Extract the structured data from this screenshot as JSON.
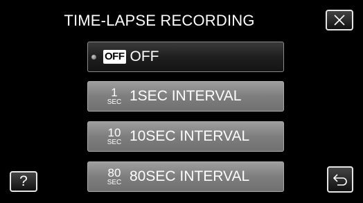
{
  "title": "TIME-LAPSE RECORDING",
  "help_label": "?",
  "icons": {
    "close": "close-icon",
    "back": "return-arrow-icon",
    "selected_indicator": "selected-dot-icon"
  },
  "options": [
    {
      "badge": "OFF",
      "label": "OFF",
      "selected": true
    },
    {
      "number": "1",
      "unit": "SEC",
      "label": "1SEC INTERVAL",
      "selected": false
    },
    {
      "number": "10",
      "unit": "SEC",
      "label": "10SEC INTERVAL",
      "selected": false
    },
    {
      "number": "80",
      "unit": "SEC",
      "label": "80SEC INTERVAL",
      "selected": false
    }
  ],
  "colors": {
    "background": "#000000",
    "selected_option": "#1f1f1f",
    "normal_option": "#808080",
    "text": "#ffffff"
  }
}
